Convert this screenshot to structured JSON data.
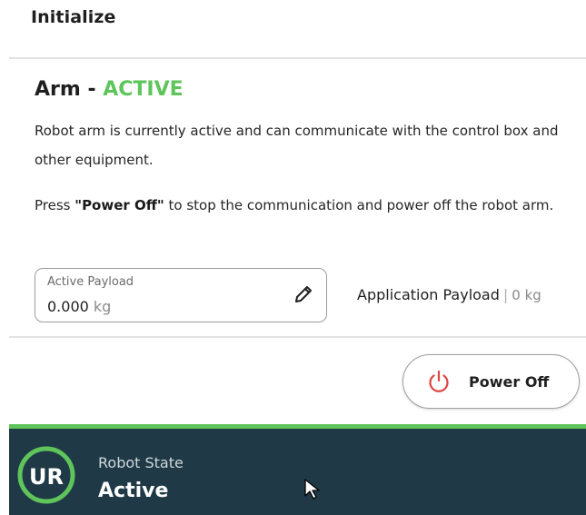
{
  "header": {
    "title": "Initialize"
  },
  "arm": {
    "heading": "Arm - ",
    "status": "ACTIVE",
    "status_color": "#5fc55b",
    "description": "Robot arm is currently active and can communicate with the control box and other equipment.",
    "instruction_prefix": "Press ",
    "instruction_button": "\"Power Off\"",
    "instruction_suffix": " to stop the communication and power off the robot arm."
  },
  "payload": {
    "active_label": "Active Payload",
    "active_value": "0.000",
    "active_unit": "kg",
    "edit_icon": "pencil-icon",
    "application_label": "Application Payload",
    "separator": "|",
    "application_value": "0 kg"
  },
  "power_button": {
    "label": "Power Off",
    "icon": "power-icon",
    "icon_color": "#e0443e"
  },
  "robot_state": {
    "label": "Robot State",
    "value": "Active",
    "logo_text": "UR",
    "bar_color": "#1f3a46",
    "accent_color": "#5fc55b"
  }
}
